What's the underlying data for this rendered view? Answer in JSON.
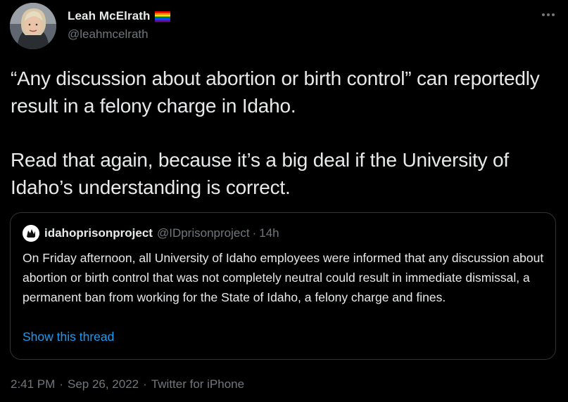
{
  "author": {
    "display_name": "Leah McElrath",
    "handle": "@leahmcelrath",
    "badge_icon": "rainbow-flag-icon",
    "avatar_icon": "profile-photo"
  },
  "menu": {
    "icon": "more-horizontal-icon"
  },
  "tweet": {
    "paragraphs": [
      "“Any discussion about abortion or birth control” can reportedly result in a felony charge in Idaho.",
      "Read that again, because it’s a big deal if the University of Idaho’s understanding is correct."
    ]
  },
  "quote": {
    "display_name": "idahoprisonproject",
    "handle": "@IDprisonproject",
    "separator": "·",
    "time": "14h",
    "body": "On Friday afternoon, all University of Idaho employees were informed that any discussion about abortion or birth control that was not completely neutral could result in immediate dismissal, a permanent ban from working for the State of Idaho, a felony charge and fines.",
    "show_thread_label": "Show this thread"
  },
  "meta": {
    "time": "2:41 PM",
    "date": "Sep 26, 2022",
    "source": "Twitter for iPhone",
    "separator": "·"
  },
  "colors": {
    "background": "#000000",
    "text_primary": "#e7e9ea",
    "text_secondary": "#71767b",
    "link": "#1d9bf0",
    "border": "#2f3336"
  }
}
